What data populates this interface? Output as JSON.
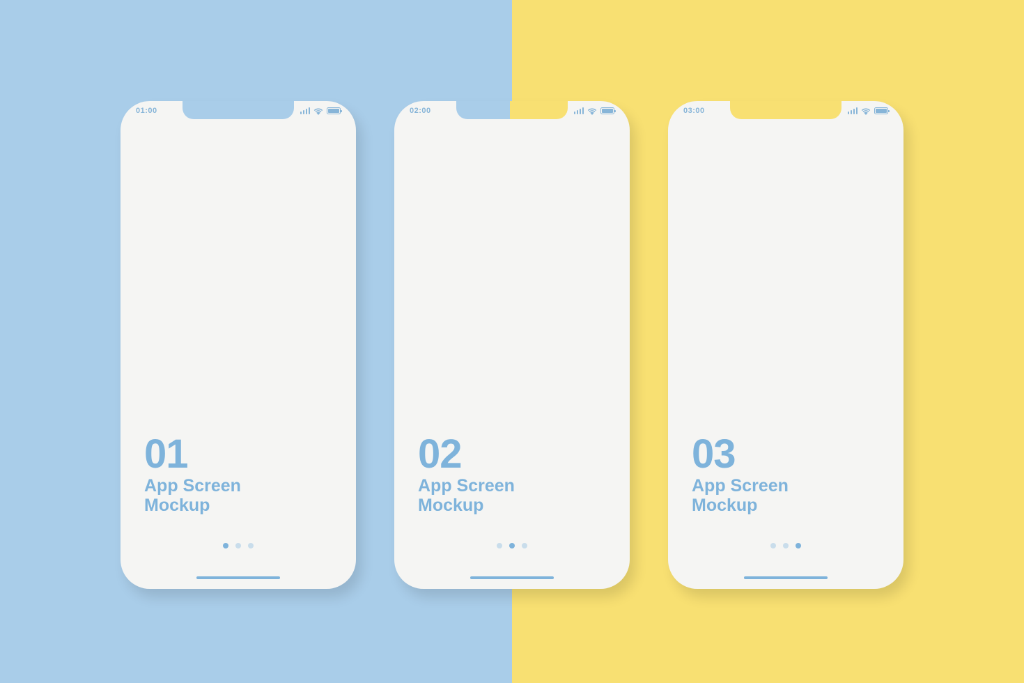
{
  "colors": {
    "bg_left": "#a9cde9",
    "bg_right": "#f8e072",
    "phone_bg": "#f5f5f3",
    "accent": "#7eb3db",
    "accent_light": "#87b5d8",
    "dot_inactive": "#c9ddeb"
  },
  "phones": [
    {
      "time": "01:00",
      "number": "01",
      "title_line1": "App Screen",
      "title_line2": "Mockup",
      "active_dot": 0
    },
    {
      "time": "02:00",
      "number": "02",
      "title_line1": "App Screen",
      "title_line2": "Mockup",
      "active_dot": 1
    },
    {
      "time": "03:00",
      "number": "03",
      "title_line1": "App Screen",
      "title_line2": "Mockup",
      "active_dot": 2
    }
  ]
}
